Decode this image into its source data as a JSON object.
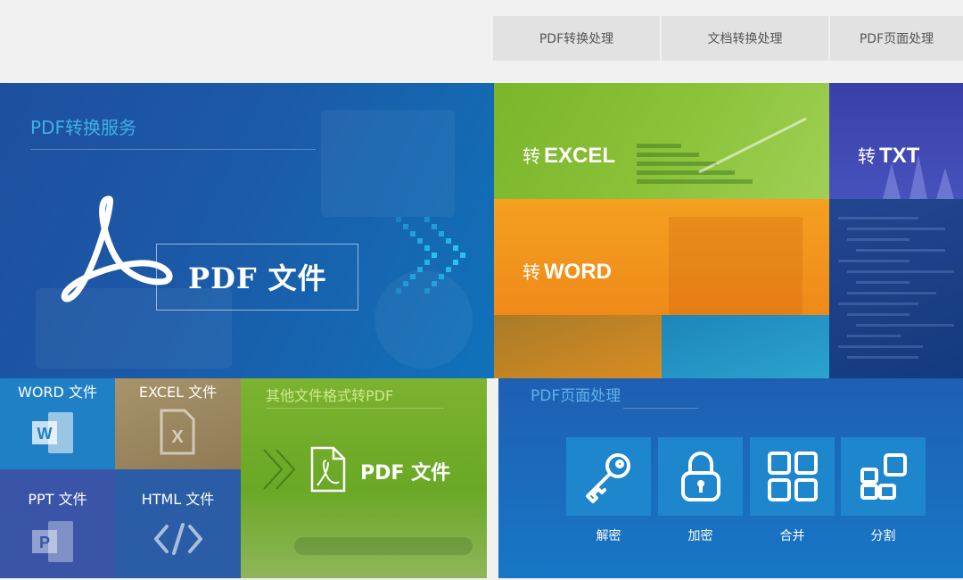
{
  "tabs": [
    "PDF转换处理",
    "文档转换处理",
    "PDF页面处理"
  ],
  "hero": {
    "title": "PDF转换服务",
    "pdf_label": "PDF 文件"
  },
  "convert_tiles": {
    "excel": {
      "prefix": "转",
      "label": "EXCEL"
    },
    "word": {
      "prefix": "转",
      "label": "WORD"
    },
    "txt": {
      "prefix": "转",
      "label": "TXT"
    }
  },
  "file_tiles": {
    "word": "WORD 文件",
    "excel": "EXCEL 文件",
    "ppt": "PPT 文件",
    "html": "HTML 文件"
  },
  "other_formats": {
    "title": "其他文件格式转PDF",
    "pdf_label": "PDF 文件"
  },
  "page_ops": {
    "title": "PDF页面处理",
    "items": [
      "解密",
      "加密",
      "合并",
      "分割"
    ]
  },
  "icons": [
    "acrobat-icon",
    "word-doc-icon",
    "excel-doc-icon",
    "ppt-doc-icon",
    "html-code-icon",
    "pdf-file-icon",
    "key-icon",
    "lock-icon",
    "merge-grid-icon",
    "split-grid-icon"
  ]
}
